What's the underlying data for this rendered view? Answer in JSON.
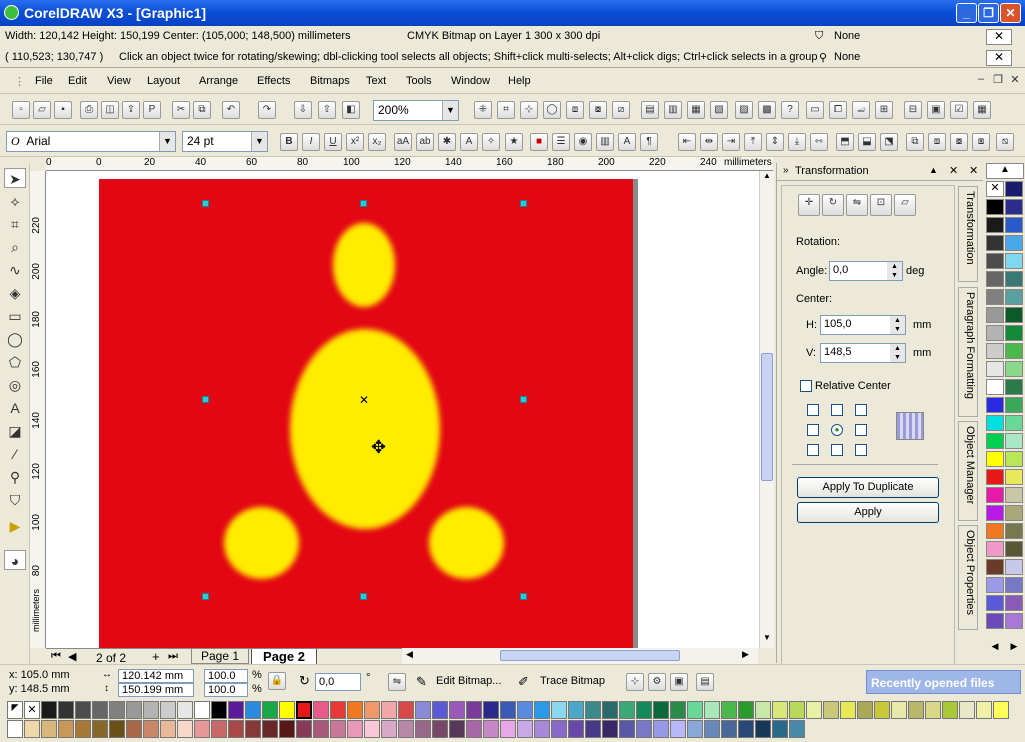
{
  "window": {
    "title": "CorelDRAW X3 - [Graphic1]"
  },
  "status": {
    "size": "Width: 120,142  Height: 150,199  Center: (105,000; 148,500)  millimeters",
    "object_info": "CMYK Bitmap on Layer 1 300 x 300 dpi",
    "fill_label": "None",
    "outline_label": "None",
    "cursor_pos": "( 110,523; 130,747 )",
    "hint": "Click an object twice for rotating/skewing; dbl-clicking tool selects all objects; Shift+click multi-selects; Alt+click digs; Ctrl+click selects in a group"
  },
  "menu": [
    "File",
    "Edit",
    "View",
    "Layout",
    "Arrange",
    "Effects",
    "Bitmaps",
    "Text",
    "Tools",
    "Window",
    "Help"
  ],
  "toolbar": {
    "zoom": "200%",
    "font": "Arial",
    "font_size": "24 pt"
  },
  "ruler": {
    "units": "millimeters",
    "top_ticks": [
      "0",
      "0",
      "20",
      "40",
      "60",
      "80",
      "100",
      "120",
      "140",
      "160",
      "180",
      "200",
      "220",
      "240"
    ],
    "left_ticks": [
      "220",
      "200",
      "180",
      "160",
      "140",
      "120",
      "100",
      "80"
    ],
    "left_units": "millimeters"
  },
  "pages": {
    "count": "2 of 2",
    "tabs": [
      "Page 1",
      "Page 2"
    ],
    "active": "Page 2"
  },
  "docker": {
    "title": "Transformation",
    "rotation_label": "Rotation:",
    "angle_label": "Angle:",
    "angle_value": "0,0",
    "angle_unit": "deg",
    "center_label": "Center:",
    "h_label": "H:",
    "h_value": "105,0",
    "h_unit": "mm",
    "v_label": "V:",
    "v_value": "148,5",
    "v_unit": "mm",
    "relative_center": "Relative Center",
    "apply_dup": "Apply To Duplicate",
    "apply": "Apply",
    "tabs": [
      "Transformation",
      "Paragraph Formatting",
      "Object Manager",
      "Object Properties"
    ]
  },
  "propbar": {
    "x": "x: 105.0 mm",
    "y": "y: 148.5 mm",
    "w": "120.142 mm",
    "h": "150.199 mm",
    "scale_x": "100.0",
    "scale_y": "100.0",
    "pct": "%",
    "angle": "0,0",
    "deg": "°",
    "edit_bitmap": "Edit Bitmap...",
    "trace_bitmap": "Trace Bitmap",
    "recent": "Recently opened files"
  },
  "colors": {
    "accent": "#0a4fd8",
    "page_fill": "#e30613",
    "blob_fill": "#ffec00",
    "handle": "#33c6d6"
  }
}
